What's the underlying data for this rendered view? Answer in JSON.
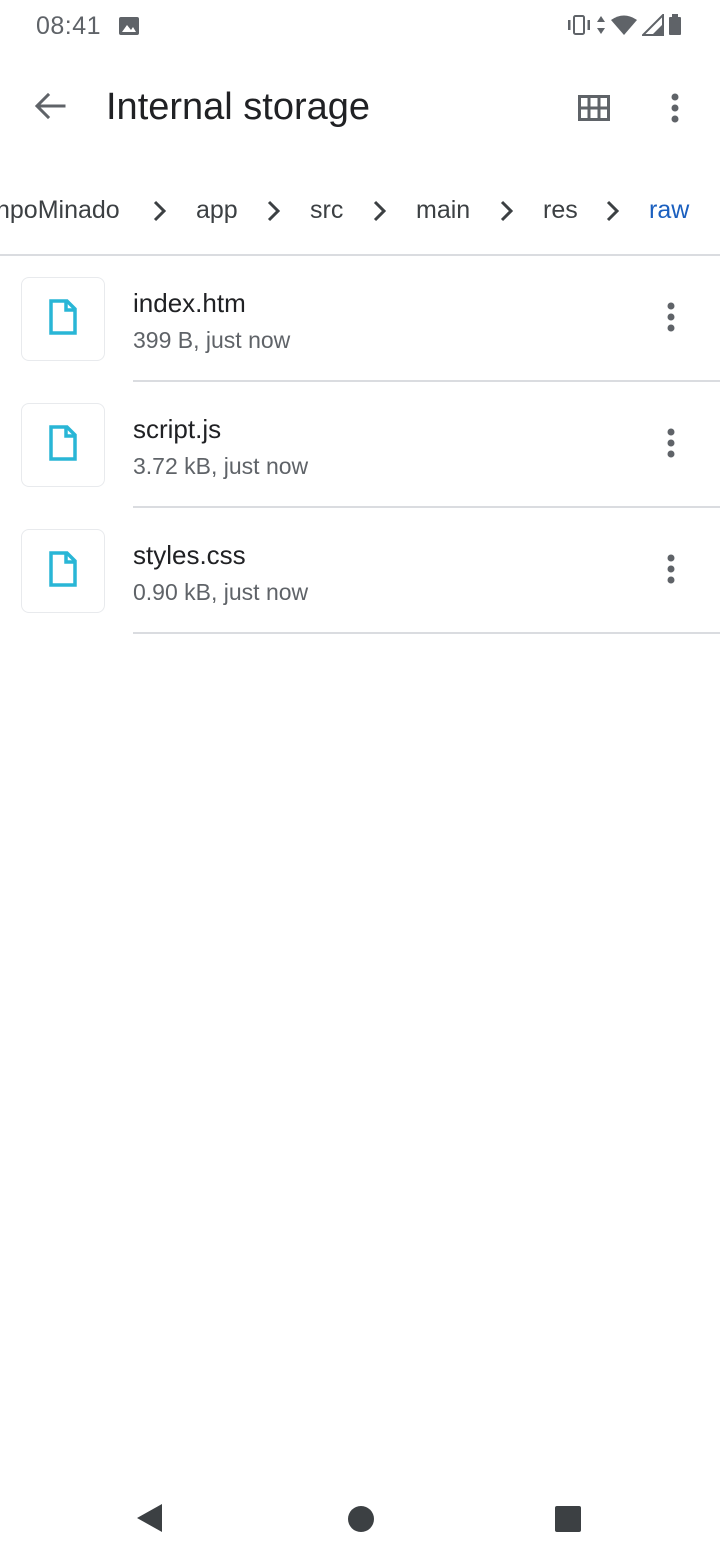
{
  "status_bar": {
    "time": "08:41",
    "icons": [
      "photo-icon",
      "vibrate-icon",
      "data-arrows-icon",
      "wifi-icon",
      "signal-icon",
      "battery-icon"
    ]
  },
  "app_bar": {
    "title": "Internal storage",
    "icons": [
      "back-arrow-icon",
      "grid-view-icon",
      "more-vert-icon"
    ]
  },
  "breadcrumb": {
    "items": [
      "npoMinado",
      "app",
      "src",
      "main",
      "res",
      "raw"
    ],
    "active_index": 5,
    "active_color": "#1a5fbf"
  },
  "files": [
    {
      "name": "index.htm",
      "meta": "399 B, just now",
      "icon": "file-icon"
    },
    {
      "name": "script.js",
      "meta": "3.72 kB, just now",
      "icon": "file-icon"
    },
    {
      "name": "styles.css",
      "meta": "0.90 kB, just now",
      "icon": "file-icon"
    }
  ],
  "colors": {
    "file_icon": "#29b6d6",
    "text_primary": "#202124",
    "text_secondary": "#5f6368",
    "divider": "#dadce0"
  },
  "nav_bar": {
    "icons": [
      "nav-back-icon",
      "nav-home-icon",
      "nav-recents-icon"
    ]
  }
}
